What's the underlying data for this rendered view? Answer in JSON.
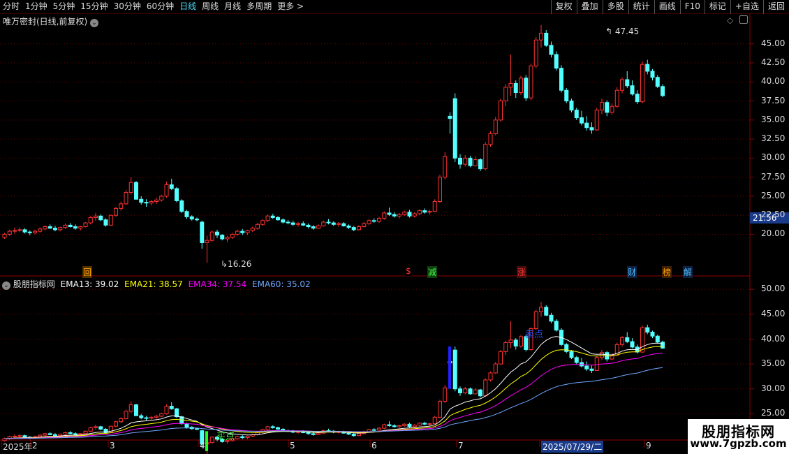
{
  "toolbar": {
    "periods": [
      "分时",
      "1分钟",
      "5分钟",
      "15分钟",
      "30分钟",
      "60分钟",
      "日线",
      "周线",
      "月线",
      "多周期",
      "更多 >"
    ],
    "active_period": "日线",
    "right_buttons": [
      "复权",
      "叠加",
      "多股",
      "统计",
      "画线",
      "F10",
      "标记",
      "+自选",
      "返回"
    ]
  },
  "chart_title": "唯万密封(日线,前复权)",
  "price_axis": [
    "45.00",
    "42.50",
    "40.00",
    "37.50",
    "35.00",
    "32.50",
    "30.00",
    "27.50",
    "25.00",
    "22.50",
    "20.00"
  ],
  "current_price": "21.56",
  "high_label": "47.45",
  "low_label": "16.26",
  "event_markers": [
    "回",
    "$",
    "减",
    "涨",
    "财",
    "榜",
    "解"
  ],
  "indicator": {
    "name": "股朋指标网",
    "ema13": "EMA13: 39.02",
    "ema21": "EMA21: 38.57",
    "ema34": "EMA34: 37.54",
    "ema60": "EMA60: 35.02",
    "axis": [
      "50.00",
      "45.00",
      "40.00",
      "35.00",
      "30.00",
      "25.00"
    ],
    "signal_sell": "卖点",
    "signal_buy": "买点"
  },
  "date_axis": [
    "2025年",
    "2",
    "3",
    "4",
    "5",
    "6",
    "7",
    "2025/07/29/二",
    "9"
  ],
  "colors": {
    "up": "#ff3232",
    "down": "#54ffff",
    "ema13": "#ffffff",
    "ema21": "#ffff00",
    "ema34": "#ff00ff",
    "ema60": "#6fa8ff"
  },
  "logo": {
    "line1": "股朋指标网",
    "line2": "www.7gpzb.com"
  },
  "chart_data": {
    "type": "candlestick",
    "y_range_main": [
      15,
      48
    ],
    "y_range_indicator": [
      20,
      52
    ],
    "ohlc": [
      [
        19.6,
        20.2,
        19.4,
        20.0
      ],
      [
        20.0,
        20.6,
        19.8,
        20.4
      ],
      [
        20.4,
        20.9,
        20.1,
        20.5
      ],
      [
        20.5,
        20.9,
        20.3,
        20.6
      ],
      [
        20.6,
        20.8,
        20.1,
        20.3
      ],
      [
        20.3,
        20.5,
        19.9,
        20.2
      ],
      [
        20.2,
        20.6,
        20.0,
        20.4
      ],
      [
        20.4,
        20.9,
        20.2,
        20.7
      ],
      [
        20.7,
        21.2,
        20.5,
        21.0
      ],
      [
        21.0,
        21.3,
        20.7,
        20.8
      ],
      [
        20.8,
        21.1,
        20.4,
        20.6
      ],
      [
        20.6,
        21.0,
        20.4,
        20.9
      ],
      [
        20.9,
        21.4,
        20.7,
        21.2
      ],
      [
        21.2,
        21.5,
        20.9,
        21.0
      ],
      [
        21.0,
        21.3,
        20.6,
        20.8
      ],
      [
        20.8,
        21.1,
        20.5,
        21.0
      ],
      [
        21.0,
        21.6,
        20.9,
        21.5
      ],
      [
        21.5,
        22.4,
        21.3,
        22.2
      ],
      [
        22.2,
        22.8,
        21.8,
        22.4
      ],
      [
        22.4,
        22.6,
        21.7,
        21.9
      ],
      [
        21.9,
        22.1,
        21.0,
        21.2
      ],
      [
        21.2,
        22.6,
        21.1,
        22.5
      ],
      [
        22.5,
        23.6,
        22.3,
        23.4
      ],
      [
        23.4,
        24.3,
        23.1,
        24.0
      ],
      [
        24.0,
        25.8,
        23.8,
        25.5
      ],
      [
        25.5,
        27.5,
        25.2,
        26.8
      ],
      [
        26.8,
        27.0,
        24.8,
        24.6
      ],
      [
        24.6,
        25.0,
        23.9,
        24.2
      ],
      [
        24.2,
        24.6,
        23.6,
        24.1
      ],
      [
        24.1,
        24.5,
        23.8,
        24.3
      ],
      [
        24.3,
        24.8,
        24.0,
        24.5
      ],
      [
        24.5,
        25.2,
        24.3,
        25.0
      ],
      [
        25.0,
        26.9,
        24.8,
        26.5
      ],
      [
        26.5,
        27.3,
        25.8,
        26.0
      ],
      [
        26.0,
        26.2,
        24.2,
        24.4
      ],
      [
        24.4,
        24.6,
        22.8,
        23.0
      ],
      [
        23.0,
        23.2,
        22.0,
        22.3
      ],
      [
        22.3,
        22.5,
        21.8,
        22.0
      ],
      [
        22.0,
        22.2,
        21.7,
        21.9
      ],
      [
        21.6,
        21.8,
        18.1,
        18.9
      ],
      [
        18.9,
        19.8,
        16.26,
        19.2
      ],
      [
        19.2,
        20.5,
        19.0,
        20.3
      ],
      [
        20.3,
        20.6,
        19.5,
        19.9
      ],
      [
        19.9,
        20.0,
        19.2,
        19.4
      ],
      [
        19.4,
        19.8,
        19.0,
        19.6
      ],
      [
        19.6,
        20.2,
        19.4,
        20.0
      ],
      [
        20.0,
        20.6,
        19.8,
        20.4
      ],
      [
        20.4,
        20.7,
        19.9,
        20.2
      ],
      [
        20.2,
        20.6,
        19.9,
        20.5
      ],
      [
        20.5,
        21.0,
        20.3,
        20.8
      ],
      [
        20.8,
        21.5,
        20.6,
        21.3
      ],
      [
        21.3,
        22.0,
        21.1,
        21.8
      ],
      [
        21.8,
        22.6,
        21.6,
        22.4
      ],
      [
        22.4,
        22.7,
        22.0,
        22.2
      ],
      [
        22.2,
        22.4,
        21.8,
        21.9
      ],
      [
        21.9,
        22.1,
        21.4,
        21.6
      ],
      [
        21.6,
        21.9,
        21.3,
        21.5
      ],
      [
        21.5,
        21.8,
        21.1,
        21.3
      ],
      [
        21.3,
        21.6,
        21.0,
        21.4
      ],
      [
        21.4,
        21.7,
        21.1,
        21.2
      ],
      [
        21.2,
        21.4,
        20.8,
        21.0
      ],
      [
        21.0,
        21.2,
        20.6,
        20.8
      ],
      [
        20.8,
        21.3,
        20.7,
        21.1
      ],
      [
        21.1,
        21.8,
        21.0,
        21.6
      ],
      [
        21.6,
        22.0,
        21.3,
        21.5
      ],
      [
        21.5,
        21.7,
        21.1,
        21.3
      ],
      [
        21.3,
        21.6,
        21.0,
        21.4
      ],
      [
        21.4,
        21.6,
        21.0,
        21.1
      ],
      [
        21.1,
        21.3,
        20.7,
        20.9
      ],
      [
        20.9,
        21.1,
        20.4,
        20.6
      ],
      [
        20.6,
        21.2,
        20.5,
        21.0
      ],
      [
        21.0,
        21.6,
        20.9,
        21.4
      ],
      [
        21.4,
        22.0,
        21.2,
        21.8
      ],
      [
        21.8,
        22.1,
        21.5,
        21.7
      ],
      [
        21.7,
        22.3,
        21.5,
        22.1
      ],
      [
        22.1,
        23.0,
        21.9,
        22.8
      ],
      [
        22.8,
        23.5,
        22.4,
        22.6
      ],
      [
        22.6,
        22.9,
        22.2,
        22.4
      ],
      [
        22.4,
        22.8,
        22.1,
        22.6
      ],
      [
        22.6,
        23.1,
        22.4,
        22.9
      ],
      [
        22.9,
        23.2,
        22.2,
        22.4
      ],
      [
        22.4,
        22.9,
        22.2,
        22.7
      ],
      [
        22.7,
        23.3,
        22.5,
        23.1
      ],
      [
        23.1,
        23.4,
        22.7,
        22.9
      ],
      [
        22.9,
        23.2,
        22.6,
        23.0
      ],
      [
        23.0,
        24.6,
        22.9,
        24.3
      ],
      [
        24.3,
        27.8,
        24.1,
        27.5
      ],
      [
        27.5,
        30.8,
        27.2,
        30.2
      ],
      [
        35.5,
        36.0,
        33.2,
        35.2
      ],
      [
        37.8,
        38.5,
        29.5,
        30.0
      ],
      [
        30.0,
        30.5,
        28.6,
        29.2
      ],
      [
        29.2,
        30.4,
        28.9,
        30.0
      ],
      [
        30.0,
        30.3,
        28.8,
        29.0
      ],
      [
        29.0,
        30.2,
        28.9,
        29.8
      ],
      [
        29.8,
        30.0,
        28.3,
        28.6
      ],
      [
        28.6,
        32.1,
        28.4,
        31.8
      ],
      [
        31.8,
        33.5,
        31.5,
        33.2
      ],
      [
        33.2,
        35.4,
        33.0,
        35.0
      ],
      [
        35.0,
        37.8,
        34.8,
        37.5
      ],
      [
        37.5,
        39.7,
        36.8,
        39.3
      ],
      [
        39.3,
        43.6,
        38.2,
        39.8
      ],
      [
        39.8,
        40.2,
        37.9,
        38.6
      ],
      [
        38.6,
        40.8,
        38.3,
        40.5
      ],
      [
        40.5,
        40.9,
        37.5,
        37.9
      ],
      [
        37.9,
        42.4,
        37.6,
        42.1
      ],
      [
        42.1,
        45.9,
        41.8,
        45.5
      ],
      [
        45.5,
        47.45,
        44.5,
        46.4
      ],
      [
        46.4,
        46.8,
        44.6,
        44.8
      ],
      [
        44.8,
        45.3,
        43.2,
        43.6
      ],
      [
        43.6,
        44.0,
        41.5,
        41.8
      ],
      [
        41.8,
        42.2,
        38.6,
        38.9
      ],
      [
        38.9,
        39.2,
        37.2,
        37.5
      ],
      [
        37.5,
        37.8,
        36.0,
        36.3
      ],
      [
        36.3,
        36.6,
        35.0,
        35.3
      ],
      [
        35.3,
        36.2,
        34.3,
        34.6
      ],
      [
        34.6,
        35.5,
        33.6,
        34.0
      ],
      [
        34.0,
        34.7,
        33.2,
        33.7
      ],
      [
        33.7,
        36.6,
        33.6,
        36.3
      ],
      [
        36.3,
        37.8,
        35.8,
        37.3
      ],
      [
        37.3,
        37.6,
        35.5,
        36.0
      ],
      [
        36.0,
        37.2,
        35.7,
        36.8
      ],
      [
        36.8,
        39.3,
        36.6,
        38.9
      ],
      [
        38.9,
        40.6,
        38.5,
        40.3
      ],
      [
        40.3,
        41.4,
        39.2,
        39.5
      ],
      [
        39.5,
        40.2,
        38.2,
        38.4
      ],
      [
        38.4,
        38.9,
        37.1,
        37.4
      ],
      [
        37.4,
        42.7,
        37.2,
        42.3
      ],
      [
        42.3,
        42.9,
        41.0,
        41.4
      ],
      [
        41.4,
        41.7,
        40.2,
        40.6
      ],
      [
        40.6,
        40.9,
        39.2,
        39.4
      ],
      [
        39.4,
        39.7,
        38.0,
        38.2
      ]
    ]
  }
}
